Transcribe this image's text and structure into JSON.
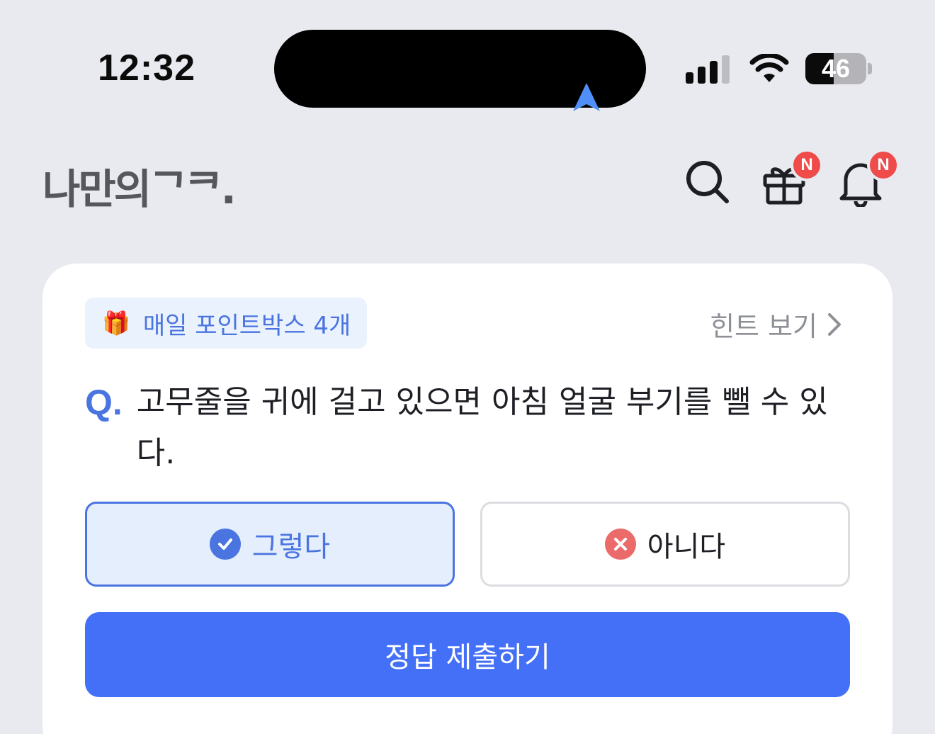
{
  "status_bar": {
    "time": "12:32",
    "battery_level": "46",
    "battery_percent": 46,
    "signal_bars_active": 3,
    "signal_bars_total": 4
  },
  "header": {
    "logo": "나만의ᄀᄏ.",
    "gift_badge": "N",
    "bell_badge": "N",
    "icons": [
      "search-icon",
      "gift-icon",
      "bell-icon"
    ]
  },
  "quiz": {
    "point_chip": "매일 포인트박스 4개",
    "hint_label": "힌트 보기",
    "question_mark": "Q.",
    "question_text": "고무줄을 귀에 걸고 있으면 아침 얼굴 부기를 뺄 수 있다.",
    "answer_yes": "그렇다",
    "answer_no": "아니다",
    "submit_label": "정답 제출하기"
  },
  "colors": {
    "accent": "#4470f7",
    "badge": "#ef4b4b",
    "no_icon": "#eb6b6b",
    "background": "#e9eaef"
  }
}
